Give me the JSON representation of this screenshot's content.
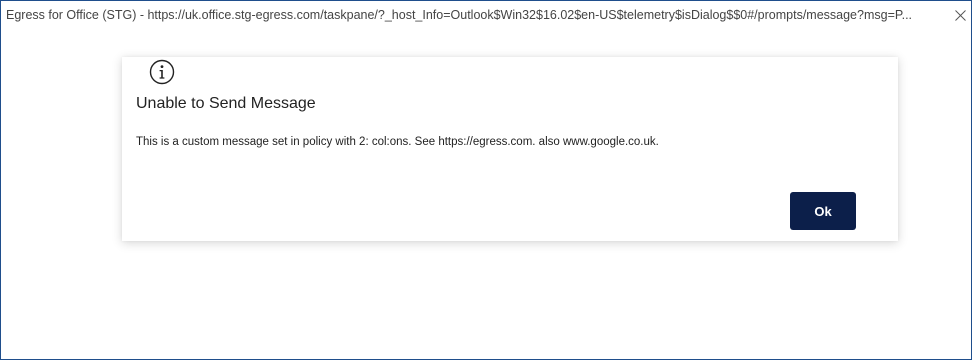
{
  "window": {
    "title": "Egress for Office (STG) - https://uk.office.stg-egress.com/taskpane/?_host_Info=Outlook$Win32$16.02$en-US$telemetry$isDialog$$0#/prompts/message?msg=P...",
    "close_icon": "close-icon"
  },
  "dialog": {
    "icon": "info-icon",
    "title": "Unable to Send Message",
    "message": "This is a custom message set in policy with 2: col:ons. See https://egress.com. also www.google.co.uk.",
    "ok_label": "Ok"
  },
  "colors": {
    "window_border": "#1f4e8c",
    "button_background": "#0c1f4a",
    "button_text": "#ffffff",
    "text": "#222222"
  }
}
